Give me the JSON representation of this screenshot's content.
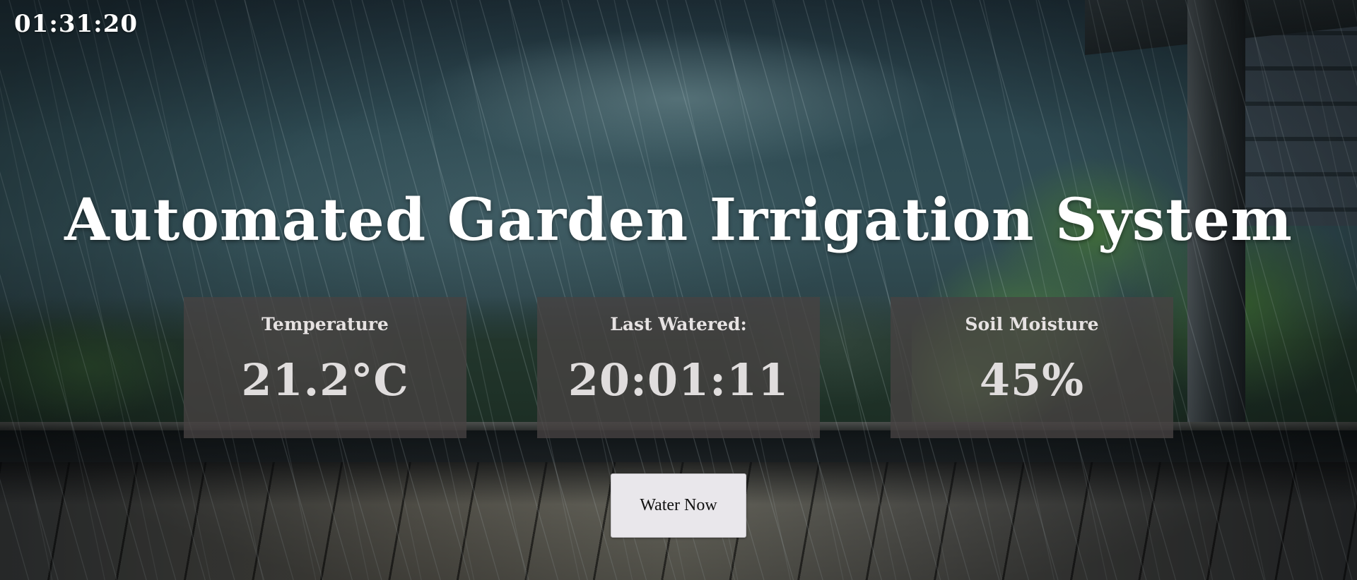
{
  "clock": {
    "time": "01:31:20"
  },
  "header": {
    "title": "Automated Garden Irrigation System"
  },
  "cards": [
    {
      "label": "Temperature",
      "value": "21.2°C"
    },
    {
      "label": "Last Watered:",
      "value": "20:01:11"
    },
    {
      "label": "Soil Moisture",
      "value": "45%"
    }
  ],
  "actions": {
    "water_now_label": "Water Now"
  },
  "theme": {
    "card_background": "#484242",
    "button_background": "#e9e7eb",
    "text_color": "#ffffff"
  }
}
